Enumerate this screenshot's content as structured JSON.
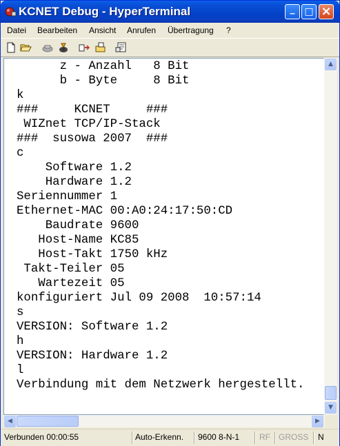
{
  "window": {
    "title": "KCNET Debug - HyperTerminal",
    "minimize_glyph": "_",
    "maximize_glyph": "□",
    "close_glyph": "×"
  },
  "menu": {
    "items": [
      {
        "label": "Datei"
      },
      {
        "label": "Bearbeiten"
      },
      {
        "label": "Ansicht"
      },
      {
        "label": "Anrufen"
      },
      {
        "label": "Übertragung"
      },
      {
        "label": "?"
      }
    ]
  },
  "toolbar": {
    "icons": [
      "new-icon",
      "open-icon",
      "disconnect-icon",
      "connect-icon",
      "send-icon",
      "receive-icon",
      "properties-icon"
    ]
  },
  "terminal": {
    "lines": [
      "      z - Anzahl   8 Bit",
      "      b - Byte     8 Bit",
      "k",
      "###     KCNET     ###",
      " WIZnet TCP/IP-Stack",
      "###  susowa 2007  ###",
      "c",
      "    Software 1.2",
      "    Hardware 1.2",
      "Seriennummer 1",
      "Ethernet-MAC 00:A0:24:17:50:CD",
      "    Baudrate 9600",
      "   Host-Name KC85",
      "   Host-Takt 1750 kHz",
      " Takt-Teiler 05",
      "   Wartezeit 05",
      "konfiguriert Jul 09 2008  10:57:14",
      "s",
      "VERSION: Software 1.2",
      "h",
      "VERSION: Hardware 1.2",
      "l",
      "Verbindung mit dem Netzwerk hergestellt."
    ]
  },
  "scrollbars": {
    "up_glyph": "▲",
    "down_glyph": "▼",
    "left_glyph": "◀",
    "right_glyph": "▶"
  },
  "status": {
    "connection": "Verbunden 00:00:55",
    "detect": "Auto-Erkenn.",
    "settings": "9600 8-N-1",
    "rf": "RF",
    "caps": "GROSS",
    "num": "N"
  }
}
